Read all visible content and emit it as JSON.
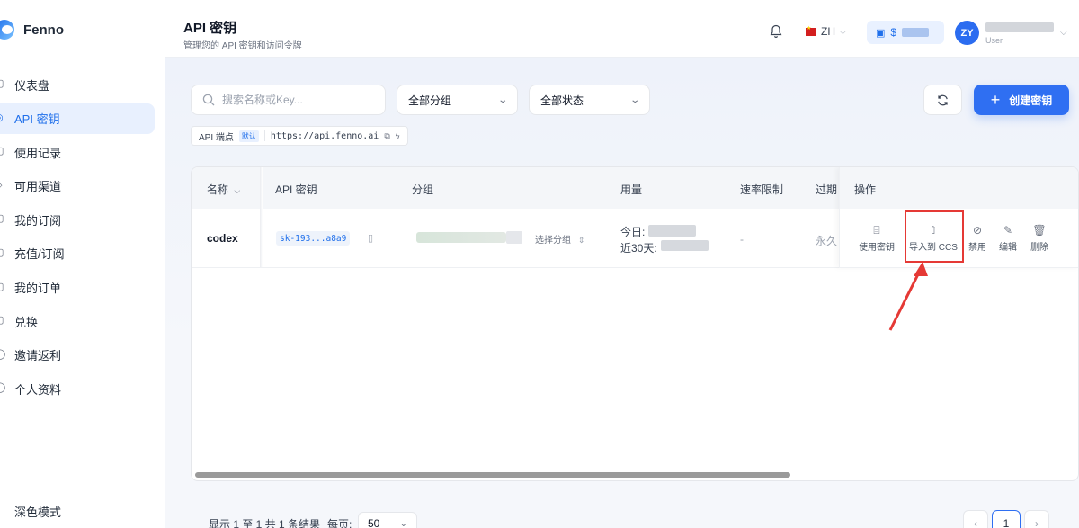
{
  "app": {
    "name": "Fenno"
  },
  "sidebar": {
    "items": [
      {
        "label": "仪表盘",
        "icon": "dashboard-icon",
        "glyph": "▢"
      },
      {
        "label": "API 密钥",
        "icon": "key-icon",
        "glyph": "◎",
        "active": true
      },
      {
        "label": "使用记录",
        "icon": "document-icon",
        "glyph": "▢"
      },
      {
        "label": "可用渠道",
        "icon": "layers-icon",
        "glyph": "◇"
      },
      {
        "label": "我的订阅",
        "icon": "subscription-icon",
        "glyph": "▢"
      },
      {
        "label": "充值/订阅",
        "icon": "wallet-icon",
        "glyph": "▢"
      },
      {
        "label": "我的订单",
        "icon": "orders-icon",
        "glyph": "▢"
      },
      {
        "label": "兑换",
        "icon": "gift-icon",
        "glyph": "▢"
      },
      {
        "label": "邀请返利",
        "icon": "invite-icon",
        "glyph": "◯"
      },
      {
        "label": "个人资料",
        "icon": "user-icon",
        "glyph": "◯"
      }
    ],
    "dark_mode_label": "深色模式"
  },
  "header": {
    "title": "API 密钥",
    "subtitle": "管理您的 API 密钥和访问令牌",
    "language": "ZH",
    "balance_prefix": "$",
    "avatar_initials": "ZY",
    "user_role": "User"
  },
  "toolbar": {
    "search_placeholder": "搜索名称或Key...",
    "group_filter": "全部分组",
    "status_filter": "全部状态",
    "create_label": "创建密钥"
  },
  "endpoint": {
    "label": "API 端点",
    "badge": "默认",
    "url": "https://api.fenno.ai"
  },
  "table": {
    "headers": {
      "name": "名称",
      "key": "API 密钥",
      "group": "分组",
      "usage": "用量",
      "rate_limit": "速率限制",
      "expires": "过期",
      "actions": "操作"
    },
    "rows": [
      {
        "name": "codex",
        "key": "sk-193...a8a9",
        "select_group": "选择分组",
        "usage_today_label": "今日:",
        "usage_30d_label": "近30天:",
        "rate_limit": "-",
        "expires": "永久"
      }
    ],
    "actions": [
      {
        "label": "使用密钥",
        "icon": "terminal-icon"
      },
      {
        "label": "导入到 CCS",
        "icon": "upload-icon"
      },
      {
        "label": "禁用",
        "icon": "ban-icon"
      },
      {
        "label": "编辑",
        "icon": "edit-icon"
      },
      {
        "label": "删除",
        "icon": "trash-icon"
      }
    ]
  },
  "pagination": {
    "summary": "显示 1 至 1 共 1 条结果",
    "per_page_label": "每页:",
    "per_page_value": "50",
    "current_page": "1"
  },
  "colors": {
    "accent": "#2f6ff2",
    "highlight": "#e53935"
  }
}
